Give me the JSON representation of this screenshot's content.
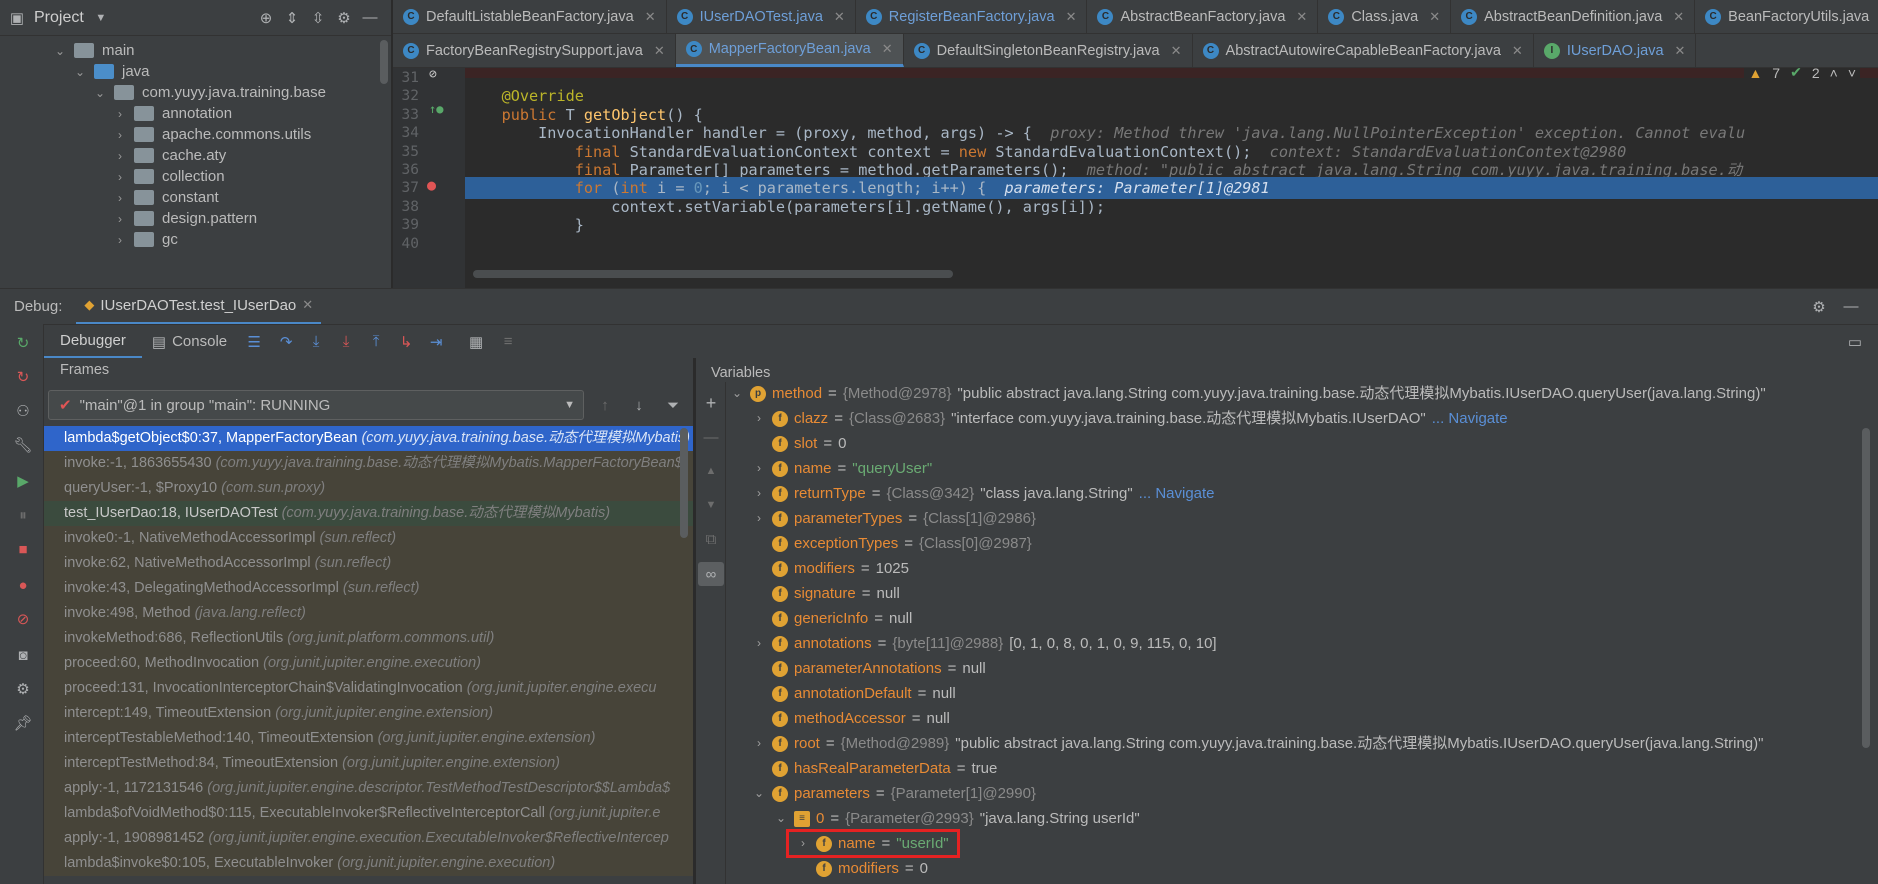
{
  "project": {
    "title": "Project"
  },
  "tree": [
    {
      "label": "main",
      "depth": 2,
      "type": "folder",
      "open": true
    },
    {
      "label": "java",
      "depth": 3,
      "type": "folder-blue",
      "open": true
    },
    {
      "label": "com.yuyy.java.training.base",
      "depth": 4,
      "type": "package",
      "open": true
    },
    {
      "label": "annotation",
      "depth": 5,
      "type": "package",
      "open": false
    },
    {
      "label": "apache.commons.utils",
      "depth": 5,
      "type": "package",
      "open": false
    },
    {
      "label": "cache.aty",
      "depth": 5,
      "type": "package",
      "open": false
    },
    {
      "label": "collection",
      "depth": 5,
      "type": "package",
      "open": false
    },
    {
      "label": "constant",
      "depth": 5,
      "type": "package",
      "open": false
    },
    {
      "label": "design.pattern",
      "depth": 5,
      "type": "package",
      "open": false
    },
    {
      "label": "gc",
      "depth": 5,
      "type": "package",
      "open": false
    }
  ],
  "tabs_row1": [
    "DefaultListableBeanFactory.java",
    "IUserDAOTest.java",
    "RegisterBeanFactory.java",
    "AbstractBeanFactory.java",
    "Class.java",
    "AbstractBeanDefinition.java",
    "BeanFactoryUtils.java"
  ],
  "tabs_row2": [
    "FactoryBeanRegistrySupport.java",
    "MapperFactoryBean.java",
    "DefaultSingletonBeanRegistry.java",
    "AbstractAutowireCapableBeanFactory.java",
    "IUserDAO.java"
  ],
  "editor": {
    "warnings": "7",
    "checks": "2",
    "lines": [
      {
        "n": "31",
        "html": ""
      },
      {
        "n": "32",
        "text": "    @Override"
      },
      {
        "n": "33",
        "text": "    public T getObject() {"
      },
      {
        "n": "34",
        "text": "        InvocationHandler handler = (proxy, method, args) -> {  ",
        "hint": "proxy: Method threw 'java.lang.NullPointerException' exception. Cannot evalu"
      },
      {
        "n": "35",
        "text": "            final StandardEvaluationContext context = new StandardEvaluationContext();  ",
        "hint": "context: StandardEvaluationContext@2980"
      },
      {
        "n": "36",
        "text": "            final Parameter[] parameters = method.getParameters();  ",
        "hint": "method: \"public abstract java.lang.String com.yuyy.java.training.base.动"
      },
      {
        "n": "37",
        "text": "            for (int i = 0; i < parameters.length; i++) {  ",
        "hint": "parameters: Parameter[1]@2981"
      },
      {
        "n": "38",
        "text": "                context.setVariable(parameters[i].getName(), args[i]);"
      },
      {
        "n": "39",
        "text": "            }"
      },
      {
        "n": "40",
        "text": ""
      }
    ]
  },
  "debug": {
    "label": "Debug:",
    "session": "IUserDAOTest.test_IUserDao",
    "tab_debugger": "Debugger",
    "tab_console": "Console"
  },
  "frames": {
    "title": "Frames",
    "thread": "\"main\"@1 in group \"main\": RUNNING",
    "items": [
      {
        "m": "lambda$getObject$0:37, MapperFactoryBean",
        "p": "(com.yuyy.java.training.base.动态代理模拟Mybatis)",
        "state": "sel"
      },
      {
        "m": "invoke:-1, 1863655430",
        "p": "(com.yuyy.java.training.base.动态代理模拟Mybatis.MapperFactoryBean$",
        "state": ""
      },
      {
        "m": "queryUser:-1, $Proxy10",
        "p": "(com.sun.proxy)",
        "state": ""
      },
      {
        "m": "test_IUserDao:18, IUserDAOTest",
        "p": "(com.yuyy.java.training.base.动态代理模拟Mybatis)",
        "state": "hi"
      },
      {
        "m": "invoke0:-1, NativeMethodAccessorImpl",
        "p": "(sun.reflect)",
        "state": ""
      },
      {
        "m": "invoke:62, NativeMethodAccessorImpl",
        "p": "(sun.reflect)",
        "state": ""
      },
      {
        "m": "invoke:43, DelegatingMethodAccessorImpl",
        "p": "(sun.reflect)",
        "state": ""
      },
      {
        "m": "invoke:498, Method",
        "p": "(java.lang.reflect)",
        "state": ""
      },
      {
        "m": "invokeMethod:686, ReflectionUtils",
        "p": "(org.junit.platform.commons.util)",
        "state": ""
      },
      {
        "m": "proceed:60, MethodInvocation",
        "p": "(org.junit.jupiter.engine.execution)",
        "state": ""
      },
      {
        "m": "proceed:131, InvocationInterceptorChain$ValidatingInvocation",
        "p": "(org.junit.jupiter.engine.execu",
        "state": ""
      },
      {
        "m": "intercept:149, TimeoutExtension",
        "p": "(org.junit.jupiter.engine.extension)",
        "state": ""
      },
      {
        "m": "interceptTestableMethod:140, TimeoutExtension",
        "p": "(org.junit.jupiter.engine.extension)",
        "state": ""
      },
      {
        "m": "interceptTestMethod:84, TimeoutExtension",
        "p": "(org.junit.jupiter.engine.extension)",
        "state": ""
      },
      {
        "m": "apply:-1, 1172131546",
        "p": "(org.junit.jupiter.engine.descriptor.TestMethodTestDescriptor$$Lambda$",
        "state": ""
      },
      {
        "m": "lambda$ofVoidMethod$0:115, ExecutableInvoker$ReflectiveInterceptorCall",
        "p": "(org.junit.jupiter.e",
        "state": ""
      },
      {
        "m": "apply:-1, 1908981452",
        "p": "(org.junit.jupiter.engine.execution.ExecutableInvoker$ReflectiveIntercep",
        "state": ""
      },
      {
        "m": "lambda$invoke$0:105, ExecutableInvoker",
        "p": "(org.junit.jupiter.engine.execution)",
        "state": ""
      }
    ]
  },
  "variables": {
    "title": "Variables",
    "items": [
      {
        "d": 0,
        "e": "open",
        "name": "method",
        "type": "{Method@2978}",
        "val": "\"public abstract java.lang.String com.yuyy.java.training.base.动态代理模拟Mybatis.IUserDAO.queryUser(java.lang.String)\"",
        "kind": "plain",
        "icon": "p"
      },
      {
        "d": 1,
        "e": "closed",
        "name": "clazz",
        "type": "{Class@2683}",
        "val": "\"interface com.yuyy.java.training.base.动态代理模拟Mybatis.IUserDAO\"",
        "nav": "... Navigate",
        "kind": "plain",
        "icon": "f"
      },
      {
        "d": 1,
        "e": "",
        "name": "slot",
        "type": "",
        "val": "0",
        "kind": "plain",
        "icon": "f"
      },
      {
        "d": 1,
        "e": "closed",
        "name": "name",
        "type": "",
        "val": "\"queryUser\"",
        "kind": "str",
        "icon": "f"
      },
      {
        "d": 1,
        "e": "closed",
        "name": "returnType",
        "type": "{Class@342}",
        "val": "\"class java.lang.String\"",
        "nav": "... Navigate",
        "kind": "plain",
        "icon": "f"
      },
      {
        "d": 1,
        "e": "closed",
        "name": "parameterTypes",
        "type": "{Class[1]@2986}",
        "val": "",
        "kind": "plain",
        "icon": "f"
      },
      {
        "d": 1,
        "e": "",
        "name": "exceptionTypes",
        "type": "{Class[0]@2987}",
        "val": "",
        "kind": "plain",
        "icon": "f"
      },
      {
        "d": 1,
        "e": "",
        "name": "modifiers",
        "type": "",
        "val": "1025",
        "kind": "plain",
        "icon": "f"
      },
      {
        "d": 1,
        "e": "",
        "name": "signature",
        "type": "",
        "val": "null",
        "kind": "plain",
        "icon": "f"
      },
      {
        "d": 1,
        "e": "",
        "name": "genericInfo",
        "type": "",
        "val": "null",
        "kind": "plain",
        "icon": "f"
      },
      {
        "d": 1,
        "e": "closed",
        "name": "annotations",
        "type": "{byte[11]@2988}",
        "val": "[0, 1, 0, 8, 0, 1, 0, 9, 115, 0, 10]",
        "kind": "plain",
        "icon": "f"
      },
      {
        "d": 1,
        "e": "",
        "name": "parameterAnnotations",
        "type": "",
        "val": "null",
        "kind": "plain",
        "icon": "f"
      },
      {
        "d": 1,
        "e": "",
        "name": "annotationDefault",
        "type": "",
        "val": "null",
        "kind": "plain",
        "icon": "f"
      },
      {
        "d": 1,
        "e": "",
        "name": "methodAccessor",
        "type": "",
        "val": "null",
        "kind": "plain",
        "icon": "f"
      },
      {
        "d": 1,
        "e": "closed",
        "name": "root",
        "type": "{Method@2989}",
        "val": "\"public abstract java.lang.String com.yuyy.java.training.base.动态代理模拟Mybatis.IUserDAO.queryUser(java.lang.String)\"",
        "kind": "plain",
        "icon": "f"
      },
      {
        "d": 1,
        "e": "",
        "name": "hasRealParameterData",
        "type": "",
        "val": "true",
        "kind": "plain",
        "icon": "f"
      },
      {
        "d": 1,
        "e": "open",
        "name": "parameters",
        "type": "{Parameter[1]@2990}",
        "val": "",
        "kind": "plain",
        "icon": "f"
      },
      {
        "d": 2,
        "e": "open",
        "name": "0",
        "type": "{Parameter@2993}",
        "val": "\"java.lang.String userId\"",
        "kind": "plain",
        "icon": "arr"
      },
      {
        "d": 3,
        "e": "closed",
        "name": "name",
        "type": "",
        "val": "\"userId\"",
        "kind": "str",
        "icon": "f",
        "boxed": true
      },
      {
        "d": 3,
        "e": "",
        "name": "modifiers",
        "type": "",
        "val": "0",
        "kind": "plain",
        "icon": "f"
      }
    ]
  }
}
